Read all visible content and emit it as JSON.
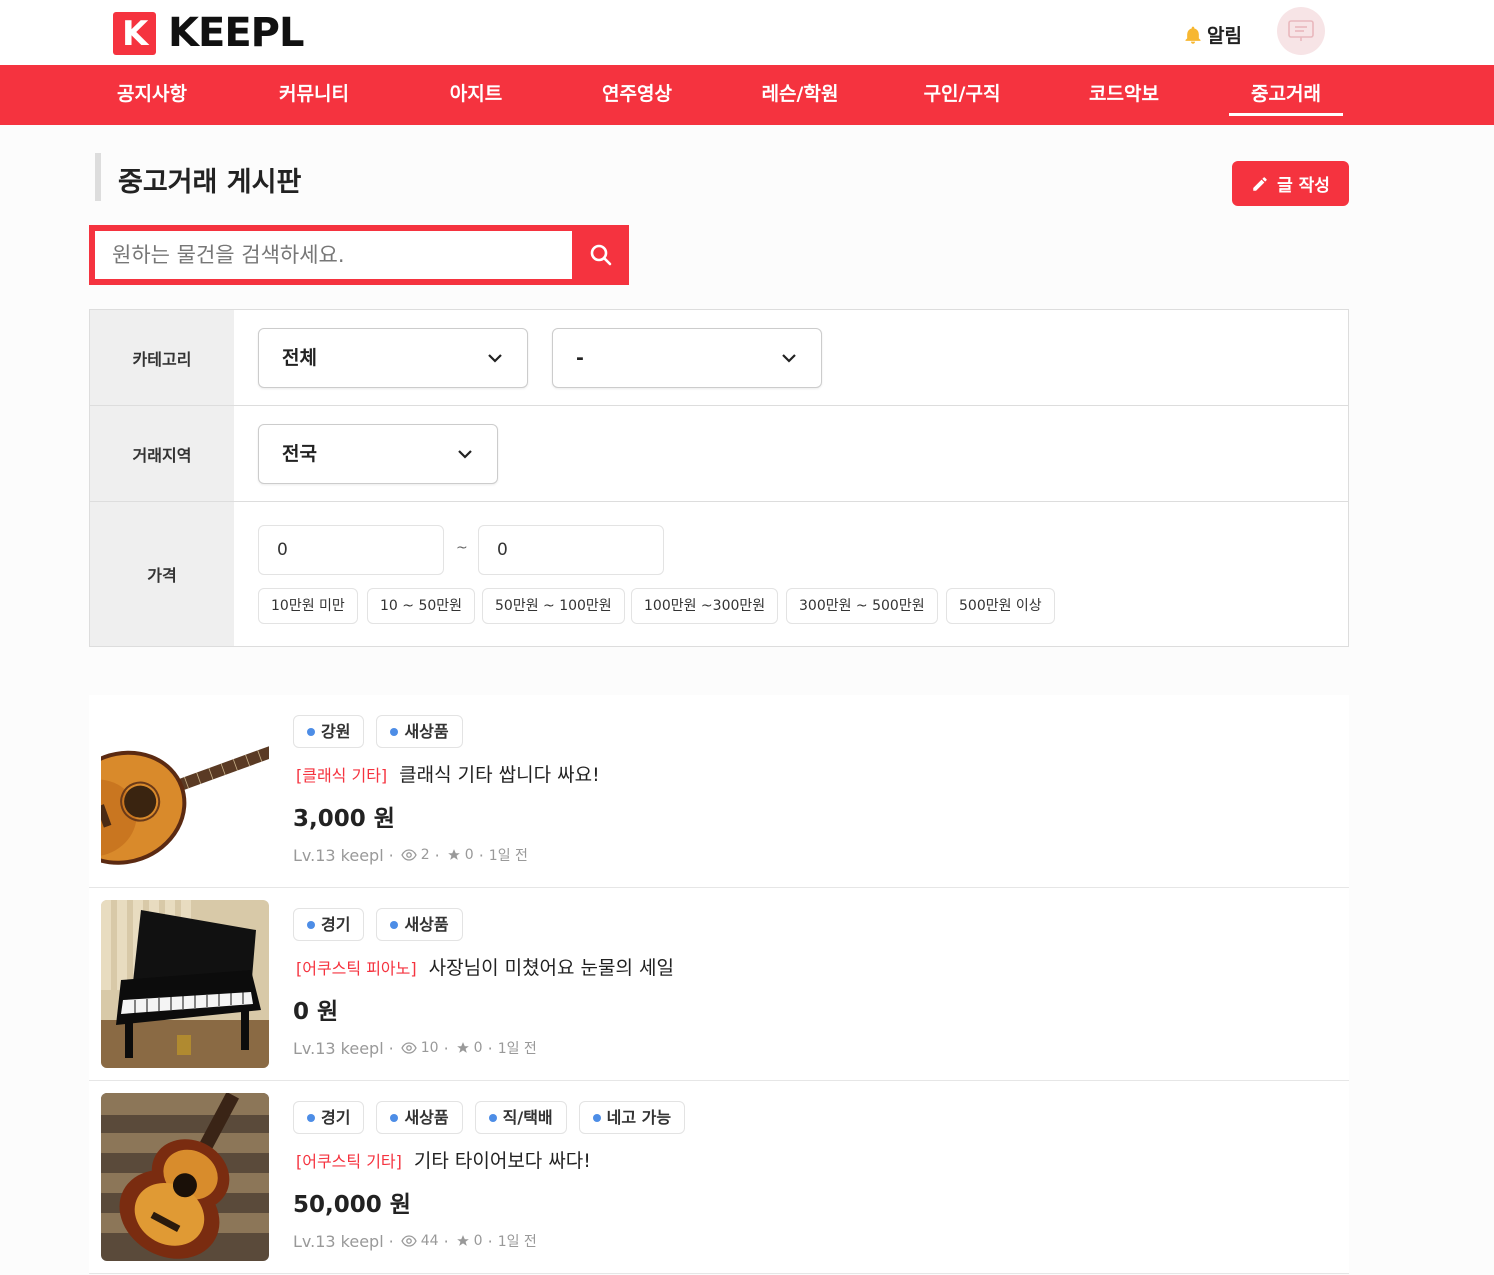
{
  "brand": {
    "name": "KEEPL",
    "color": "#f5333f"
  },
  "header": {
    "alarm_label": "알림"
  },
  "nav": [
    {
      "label": "공지사항"
    },
    {
      "label": "커뮤니티"
    },
    {
      "label": "아지트"
    },
    {
      "label": "연주영상"
    },
    {
      "label": "레슨/학원"
    },
    {
      "label": "구인/구직"
    },
    {
      "label": "코드악보"
    },
    {
      "label": "중고거래",
      "active": true
    }
  ],
  "page": {
    "title": "중고거래 게시판",
    "write_button": "글 작성"
  },
  "search": {
    "placeholder": "원하는 물건을 검색하세요.",
    "value": ""
  },
  "filter": {
    "category_label": "카테고리",
    "category_main": "전체",
    "category_sub": "-",
    "region_label": "거래지역",
    "region": "전국",
    "price_label": "가격",
    "price_min": "0",
    "price_sep": "~",
    "price_max": "0",
    "price_chips": [
      "10만원 미만",
      "10 ~ 50만원",
      "50만원 ~ 100만원",
      "100만원 ~300만원",
      "300만원 ~ 500만원",
      "500만원 이상"
    ]
  },
  "items": [
    {
      "tags": [
        "강원",
        "새상품"
      ],
      "category": "[클래식 기타]",
      "title": "클래식 기타 쌉니다 싸요!",
      "price": "3,000 원",
      "level": "Lv.13 keepl",
      "views": "2",
      "likes": "0",
      "time": "1일 전",
      "image": "classical-guitar"
    },
    {
      "tags": [
        "경기",
        "새상품"
      ],
      "category": "[어쿠스틱 피아노]",
      "title": "사장님이 미쳤어요 눈물의 세일",
      "price": "0 원",
      "level": "Lv.13 keepl",
      "views": "10",
      "likes": "0",
      "time": "1일 전",
      "image": "grand-piano"
    },
    {
      "tags": [
        "경기",
        "새상품",
        "직/택배",
        "네고 가능"
      ],
      "category": "[어쿠스틱 기타]",
      "title": "기타 타이어보다 싸다!",
      "price": "50,000 원",
      "level": "Lv.13 keepl",
      "views": "44",
      "likes": "0",
      "time": "1일 전",
      "image": "acoustic-guitar"
    }
  ]
}
